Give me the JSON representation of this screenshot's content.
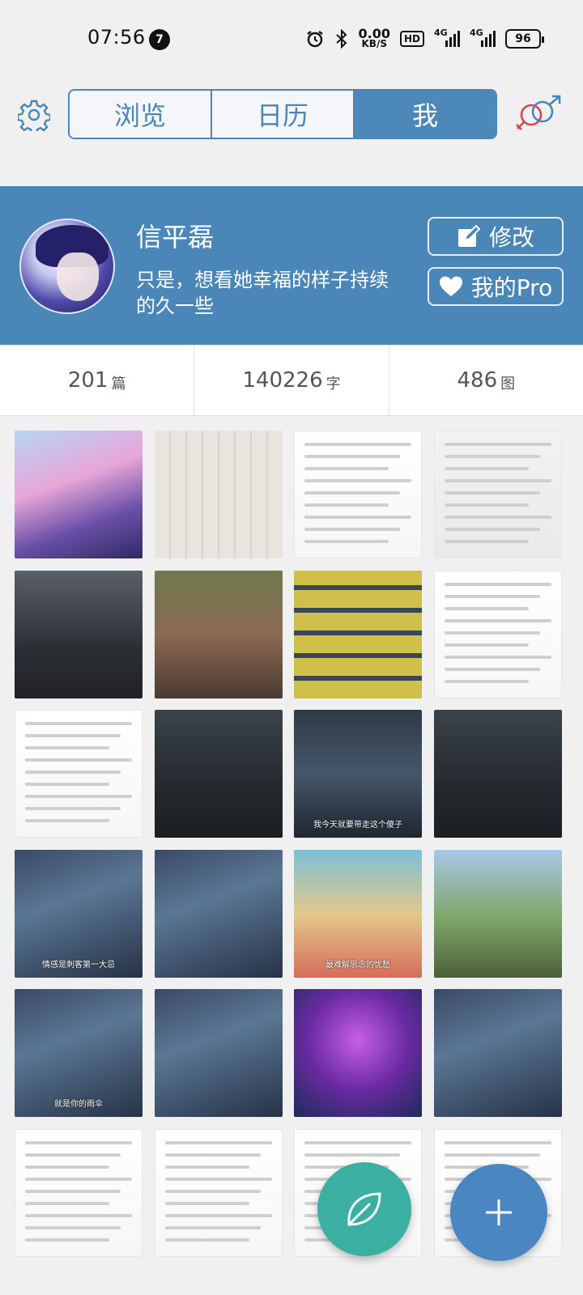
{
  "status_bar": {
    "time": "07:56",
    "notification_count": "7",
    "net_speed_value": "0.00",
    "net_speed_unit": "KB/S",
    "hd_label": "HD",
    "net_label_1": "4G",
    "net_label_2": "4G",
    "battery": "96"
  },
  "tabs": [
    "浏览",
    "日历",
    "我"
  ],
  "selected_tab": "我",
  "profile": {
    "name": "信平磊",
    "bio": "只是，想看她幸福的样子持续的久一些",
    "edit_label": "修改",
    "pro_label": "我的Pro"
  },
  "stats": [
    {
      "value": "201",
      "unit": "篇"
    },
    {
      "value": "140226",
      "unit": "字"
    },
    {
      "value": "486",
      "unit": "图"
    }
  ],
  "thumbnails": [
    {
      "kind": "anime-girl",
      "caption": ""
    },
    {
      "kind": "handwriting",
      "caption": ""
    },
    {
      "kind": "game-list",
      "caption": ""
    },
    {
      "kind": "chat",
      "caption": ""
    },
    {
      "kind": "game-crowd",
      "caption": ""
    },
    {
      "kind": "game-dance",
      "caption": ""
    },
    {
      "kind": "game-grid",
      "caption": ""
    },
    {
      "kind": "text-post",
      "caption": ""
    },
    {
      "kind": "text-post",
      "caption": ""
    },
    {
      "kind": "dark-scene",
      "caption": ""
    },
    {
      "kind": "cartoon",
      "caption": "我今天就要带走这个傻子"
    },
    {
      "kind": "dark-scene",
      "caption": ""
    },
    {
      "kind": "anime",
      "caption": "情感是刺客第一大忌"
    },
    {
      "kind": "anime",
      "caption": ""
    },
    {
      "kind": "cartoon-crowd",
      "caption": "最难解思念的忧愁"
    },
    {
      "kind": "landscape",
      "caption": ""
    },
    {
      "kind": "anime",
      "caption": "就是你的雨伞"
    },
    {
      "kind": "anime",
      "caption": ""
    },
    {
      "kind": "anime-purple",
      "caption": ""
    },
    {
      "kind": "anime",
      "caption": ""
    },
    {
      "kind": "text-post",
      "caption": ""
    },
    {
      "kind": "text-post",
      "caption": ""
    },
    {
      "kind": "text-post",
      "caption": ""
    },
    {
      "kind": "text-post",
      "caption": ""
    }
  ],
  "colors": {
    "primary": "#4a86b8",
    "fab_leaf": "#3aafa2",
    "fab_add": "#4a86c2",
    "gender_female": "#e0424a",
    "gender_male": "#4a86b8"
  },
  "icons": {
    "settings": "gear-icon",
    "gender": "gender-icon",
    "edit": "edit-icon",
    "pro": "heart-icon",
    "new_entry": "leaf-icon",
    "add": "plus-icon"
  }
}
